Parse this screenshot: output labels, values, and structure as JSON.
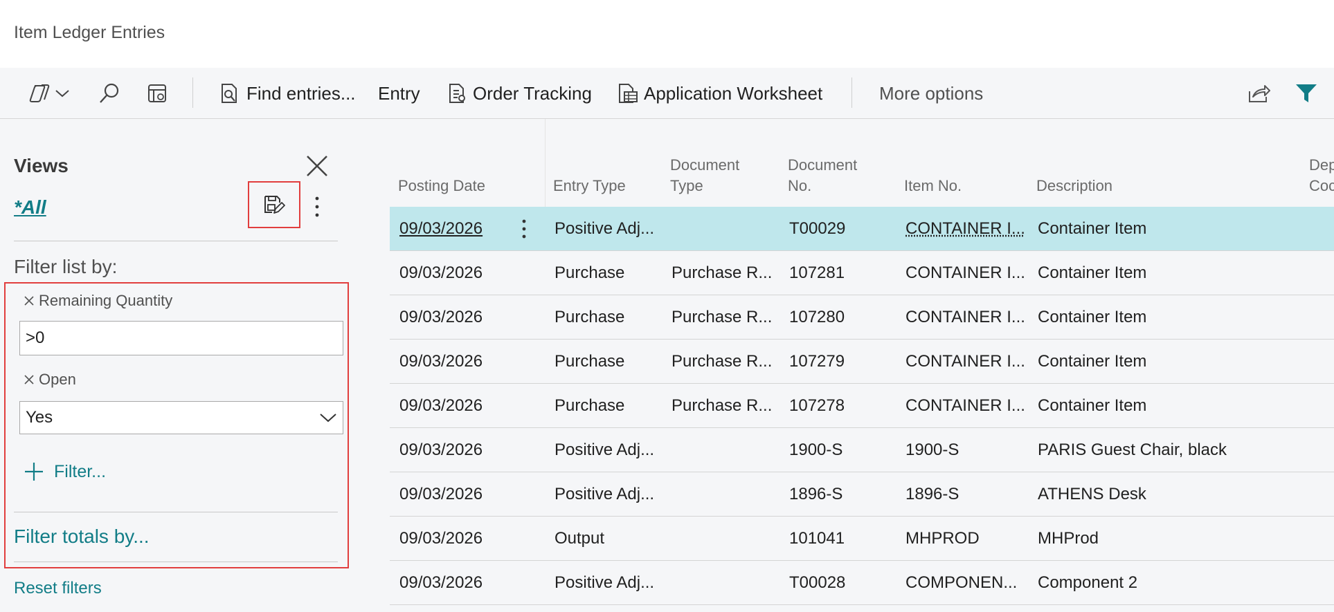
{
  "page": {
    "title": "Item Ledger Entries"
  },
  "toolbar": {
    "find_entries": "Find entries...",
    "entry": "Entry",
    "order_tracking": "Order Tracking",
    "application_worksheet": "Application Worksheet",
    "more_options": "More options"
  },
  "views": {
    "title": "Views",
    "current": "*All",
    "filter_heading": "Filter list by:",
    "filters": [
      {
        "label": "Remaining Quantity",
        "value": ">0"
      },
      {
        "label": "Open",
        "value": "Yes"
      }
    ],
    "add_filter": "Filter...",
    "filter_totals": "Filter totals by...",
    "reset_filters": "Reset filters"
  },
  "table": {
    "headers": {
      "posting_date": "Posting Date",
      "entry_type": "Entry Type",
      "document_type_1": "Document",
      "document_type_2": "Type",
      "document_no_1": "Document",
      "document_no_2": "No.",
      "item_no": "Item No.",
      "description": "Description",
      "dept_code_1": "Dep",
      "dept_code_2": "Coc"
    },
    "rows": [
      {
        "posting_date": "09/03/2026",
        "entry_type": "Positive Adj...",
        "document_type": "",
        "document_no": "T00029",
        "item_no": "CONTAINER I...",
        "description": "Container Item"
      },
      {
        "posting_date": "09/03/2026",
        "entry_type": "Purchase",
        "document_type": "Purchase R...",
        "document_no": "107281",
        "item_no": "CONTAINER I...",
        "description": "Container Item"
      },
      {
        "posting_date": "09/03/2026",
        "entry_type": "Purchase",
        "document_type": "Purchase R...",
        "document_no": "107280",
        "item_no": "CONTAINER I...",
        "description": "Container Item"
      },
      {
        "posting_date": "09/03/2026",
        "entry_type": "Purchase",
        "document_type": "Purchase R...",
        "document_no": "107279",
        "item_no": "CONTAINER I...",
        "description": "Container Item"
      },
      {
        "posting_date": "09/03/2026",
        "entry_type": "Purchase",
        "document_type": "Purchase R...",
        "document_no": "107278",
        "item_no": "CONTAINER I...",
        "description": "Container Item"
      },
      {
        "posting_date": "09/03/2026",
        "entry_type": "Positive Adj...",
        "document_type": "",
        "document_no": "1900-S",
        "item_no": "1900-S",
        "description": "PARIS Guest Chair, black"
      },
      {
        "posting_date": "09/03/2026",
        "entry_type": "Positive Adj...",
        "document_type": "",
        "document_no": "1896-S",
        "item_no": "1896-S",
        "description": "ATHENS Desk"
      },
      {
        "posting_date": "09/03/2026",
        "entry_type": "Output",
        "document_type": "",
        "document_no": "101041",
        "item_no": "MHPROD",
        "description": "MHProd"
      },
      {
        "posting_date": "09/03/2026",
        "entry_type": "Positive Adj...",
        "document_type": "",
        "document_no": "T00028",
        "item_no": "COMPONEN...",
        "description": "Component 2"
      }
    ]
  },
  "colors": {
    "accent": "#127d87",
    "selected_row": "#bfe7ec",
    "highlight_box": "#e13d3d"
  }
}
